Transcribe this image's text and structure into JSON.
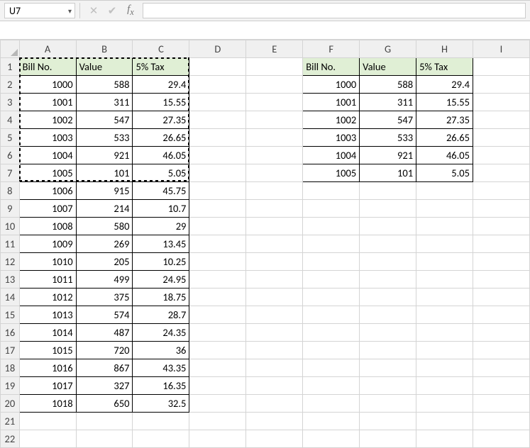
{
  "namebox": {
    "value": "U7"
  },
  "formula_bar": {
    "value": ""
  },
  "columns": [
    "A",
    "B",
    "C",
    "D",
    "E",
    "F",
    "G",
    "H",
    "I"
  ],
  "row_numbers": [
    1,
    2,
    3,
    4,
    5,
    6,
    7,
    8,
    9,
    10,
    11,
    12,
    13,
    14,
    15,
    16,
    17,
    18,
    19,
    20,
    21,
    22
  ],
  "headers_left": {
    "bill": "Bill No.",
    "value": "Value",
    "tax": "5% Tax"
  },
  "headers_right": {
    "bill": "Bill No.",
    "value": "Value",
    "tax": "5% Tax"
  },
  "left_table": [
    {
      "bill": 1000,
      "value": 588,
      "tax": 29.4
    },
    {
      "bill": 1001,
      "value": 311,
      "tax": 15.55
    },
    {
      "bill": 1002,
      "value": 547,
      "tax": 27.35
    },
    {
      "bill": 1003,
      "value": 533,
      "tax": 26.65
    },
    {
      "bill": 1004,
      "value": 921,
      "tax": 46.05
    },
    {
      "bill": 1005,
      "value": 101,
      "tax": 5.05
    },
    {
      "bill": 1006,
      "value": 915,
      "tax": 45.75
    },
    {
      "bill": 1007,
      "value": 214,
      "tax": 10.7
    },
    {
      "bill": 1008,
      "value": 580,
      "tax": 29
    },
    {
      "bill": 1009,
      "value": 269,
      "tax": 13.45
    },
    {
      "bill": 1010,
      "value": 205,
      "tax": 10.25
    },
    {
      "bill": 1011,
      "value": 499,
      "tax": 24.95
    },
    {
      "bill": 1012,
      "value": 375,
      "tax": 18.75
    },
    {
      "bill": 1013,
      "value": 574,
      "tax": 28.7
    },
    {
      "bill": 1014,
      "value": 487,
      "tax": 24.35
    },
    {
      "bill": 1015,
      "value": 720,
      "tax": 36
    },
    {
      "bill": 1016,
      "value": 867,
      "tax": 43.35
    },
    {
      "bill": 1017,
      "value": 327,
      "tax": 16.35
    },
    {
      "bill": 1018,
      "value": 650,
      "tax": 32.5
    }
  ],
  "right_table": [
    {
      "bill": 1000,
      "value": 588,
      "tax": 29.4
    },
    {
      "bill": 1001,
      "value": 311,
      "tax": 15.55
    },
    {
      "bill": 1002,
      "value": 547,
      "tax": 27.35
    },
    {
      "bill": 1003,
      "value": 533,
      "tax": 26.65
    },
    {
      "bill": 1004,
      "value": 921,
      "tax": 46.05
    },
    {
      "bill": 1005,
      "value": 101,
      "tax": 5.05
    }
  ],
  "copied_range": {
    "sheet_ref": "A1:C7"
  }
}
